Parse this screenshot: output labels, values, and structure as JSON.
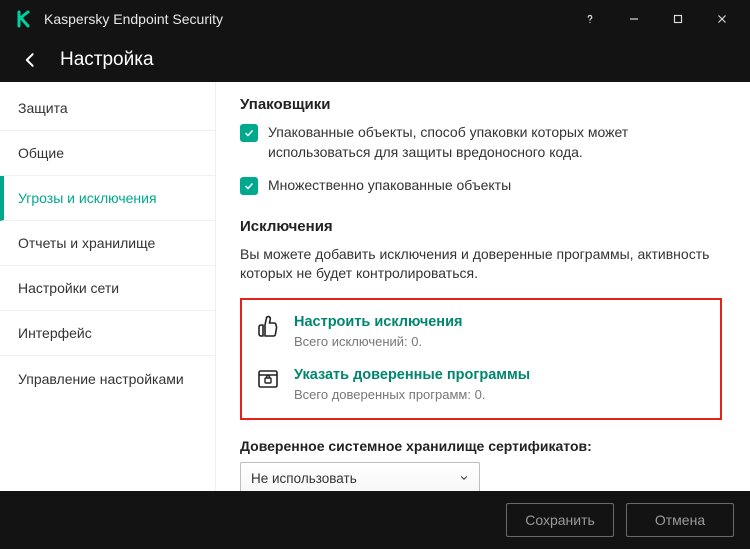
{
  "titlebar": {
    "title": "Kaspersky Endpoint Security"
  },
  "header": {
    "page_title": "Настройка"
  },
  "sidebar": {
    "items": [
      {
        "label": "Защита"
      },
      {
        "label": "Общие"
      },
      {
        "label": "Угрозы и исключения"
      },
      {
        "label": "Отчеты и хранилище"
      },
      {
        "label": "Настройки сети"
      },
      {
        "label": "Интерфейс"
      },
      {
        "label": "Управление настройками"
      }
    ],
    "active_index": 2
  },
  "main": {
    "packers": {
      "title": "Упаковщики",
      "check1": "Упакованные объекты, способ упаковки которых может использоваться для защиты вредоносного кода.",
      "check2": "Множественно упакованные объекты"
    },
    "exclusions": {
      "title": "Исключения",
      "desc": "Вы можете добавить исключения и доверенные программы, активность которых не будет контролироваться.",
      "configure": {
        "label": "Настроить исключения",
        "sub": "Всего исключений: 0."
      },
      "trusted": {
        "label": "Указать доверенные программы",
        "sub": "Всего доверенных программ: 0."
      }
    },
    "certstore": {
      "label": "Доверенное системное хранилище сертификатов:",
      "value": "Не использовать"
    }
  },
  "footer": {
    "save": "Сохранить",
    "cancel": "Отмена"
  }
}
